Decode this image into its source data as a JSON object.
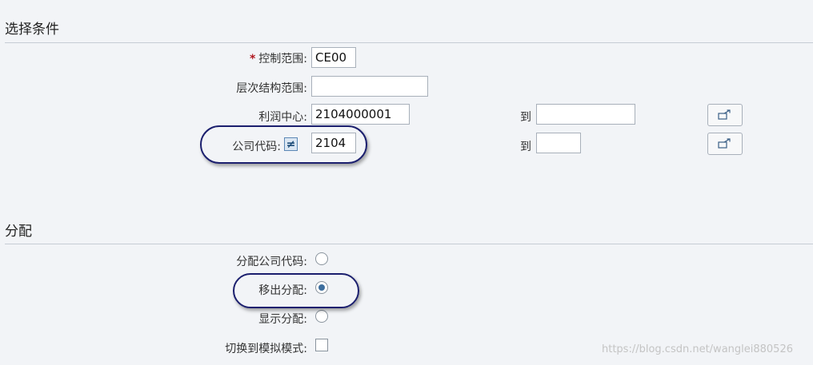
{
  "selection": {
    "title": "选择条件",
    "fields": {
      "control_area": {
        "label": "控制范围:",
        "required_mark": "*",
        "value": "CE00"
      },
      "hierarchy_area": {
        "label": "层次结构范围:",
        "value": ""
      },
      "profit_center": {
        "label": "利润中心:",
        "from_value": "2104000001",
        "to_label": "到",
        "to_value": ""
      },
      "company_code": {
        "label": "公司代码:",
        "operator_icon": "not-equal-icon",
        "operator_symbol": "≠",
        "from_value": "2104",
        "to_label": "到",
        "to_value": ""
      }
    }
  },
  "assignment": {
    "title": "分配",
    "options": {
      "assign_company_code": {
        "label": "分配公司代码:",
        "checked": false
      },
      "move_out_assignment": {
        "label": "移出分配:",
        "checked": true
      },
      "show_assignment": {
        "label": "显示分配:",
        "checked": false
      }
    },
    "simulation_mode": {
      "label": "切换到模拟模式:",
      "checked": false
    }
  },
  "watermark": "https://blog.csdn.net/wanglei880526",
  "colors": {
    "background": "#f2f4f7",
    "required": "#b0171f",
    "highlight_ring": "#1b1f6e",
    "radio_selected": "#3d6e9e"
  }
}
